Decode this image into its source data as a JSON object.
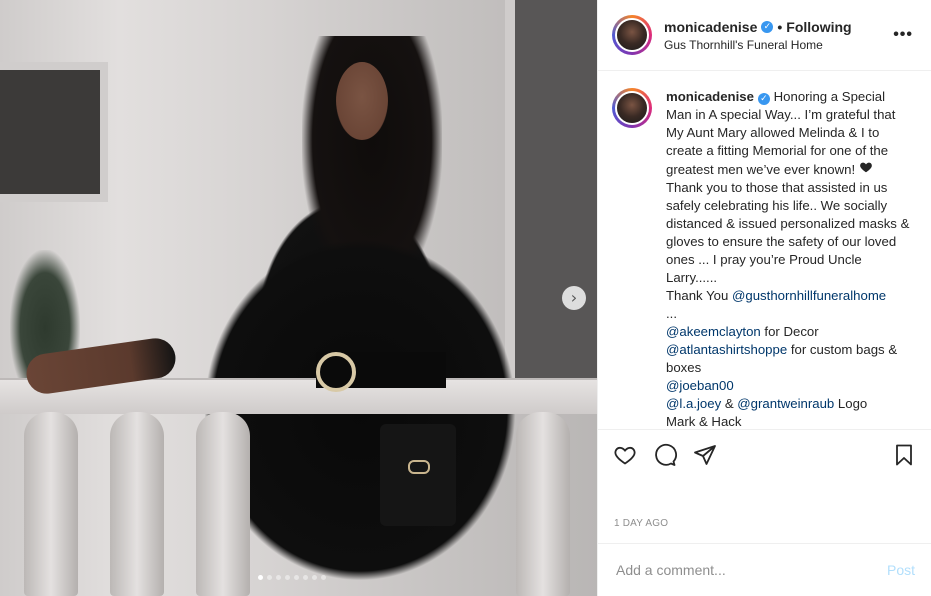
{
  "post": {
    "username": "monicadenise",
    "follow_separator": "•",
    "follow_status": "Following",
    "location": "Gus Thornhill's Funeral Home",
    "more_label": "•••",
    "next_label": "›",
    "carousel": {
      "count": 8,
      "active_index": 0
    }
  },
  "caption": {
    "username": "monicadenise",
    "p1": "Honoring a Special Man in A special Way... I’m grateful that My Aunt Mary allowed Melinda & I to create a fitting Memorial for one of the greatest men we’ve ever known! ",
    "p2": " Thank you to those that assisted in us safely celebrating his life.. We socially distanced & issued personalized masks & gloves to ensure the safety of our loved ones ... I pray you’re Proud Uncle Larry......\nThank You ",
    "mention_funeral_home": "@gusthornhillfuneralhome",
    "ellipsis": "\n...\n",
    "mention_decor": "@akeemclayton",
    "decor_text": " for Decor\n",
    "mention_shirts": "@atlantashirtshoppe",
    "shirts_text": " for custom bags & boxes\n",
    "mention_joe": "@joeban00",
    "newline": "\n",
    "mention_lajoey": "@l.a.joey",
    "and_text": " & ",
    "mention_grant": "@grantweinraub",
    "logo_text": " Logo\nMark & Hack"
  },
  "footer": {
    "timestamp": "1 DAY AGO",
    "comment_placeholder": "Add a comment...",
    "post_label": "Post"
  },
  "colors": {
    "link": "#00376b",
    "verified": "#3897f0",
    "post_button": "#b2dffc"
  },
  "icons": [
    "verified-badge-icon",
    "more-options-icon",
    "carousel-next-icon",
    "heart-icon",
    "comment-icon",
    "share-icon",
    "bookmark-icon",
    "black-heart-emoji-icon"
  ]
}
